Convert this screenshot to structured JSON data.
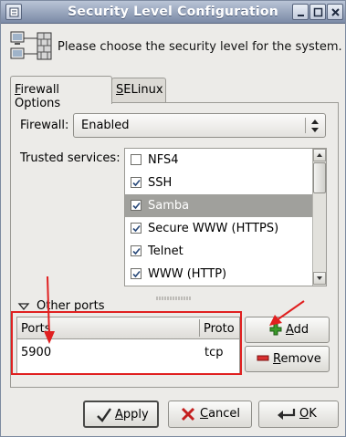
{
  "window": {
    "title": "Security Level Configuration"
  },
  "header": {
    "text": "Please choose the security level for the system."
  },
  "tabs": [
    {
      "label_ul": "F",
      "label_rest": "irewall Options",
      "active": true
    },
    {
      "label_ul": "S",
      "label_rest": "ELinux",
      "active": false
    }
  ],
  "firewall": {
    "label": "Firewall:",
    "value": "Enabled"
  },
  "trusted_services": {
    "label": "Trusted services:",
    "items": [
      {
        "label": "NFS4",
        "checked": false,
        "selected": false
      },
      {
        "label": "SSH",
        "checked": true,
        "selected": false
      },
      {
        "label": "Samba",
        "checked": true,
        "selected": true
      },
      {
        "label": "Secure WWW (HTTPS)",
        "checked": true,
        "selected": false
      },
      {
        "label": "Telnet",
        "checked": true,
        "selected": false
      },
      {
        "label": "WWW (HTTP)",
        "checked": true,
        "selected": false
      }
    ]
  },
  "other_ports": {
    "label": "Other ports",
    "columns": [
      "Ports",
      "Proto"
    ],
    "rows": [
      {
        "port": "5900",
        "proto": "tcp"
      }
    ]
  },
  "buttons": {
    "add_ul": "A",
    "add_rest": "dd",
    "remove_ul": "R",
    "remove_rest": "emove",
    "apply_ul": "A",
    "apply_rest": "pply",
    "cancel_ul": "C",
    "cancel_rest": "ancel",
    "ok_ul": "O",
    "ok_rest": "K"
  },
  "colors": {
    "annotation": "#e02020",
    "titlebar": "#8a98b4",
    "selection": "#a0a09c"
  }
}
